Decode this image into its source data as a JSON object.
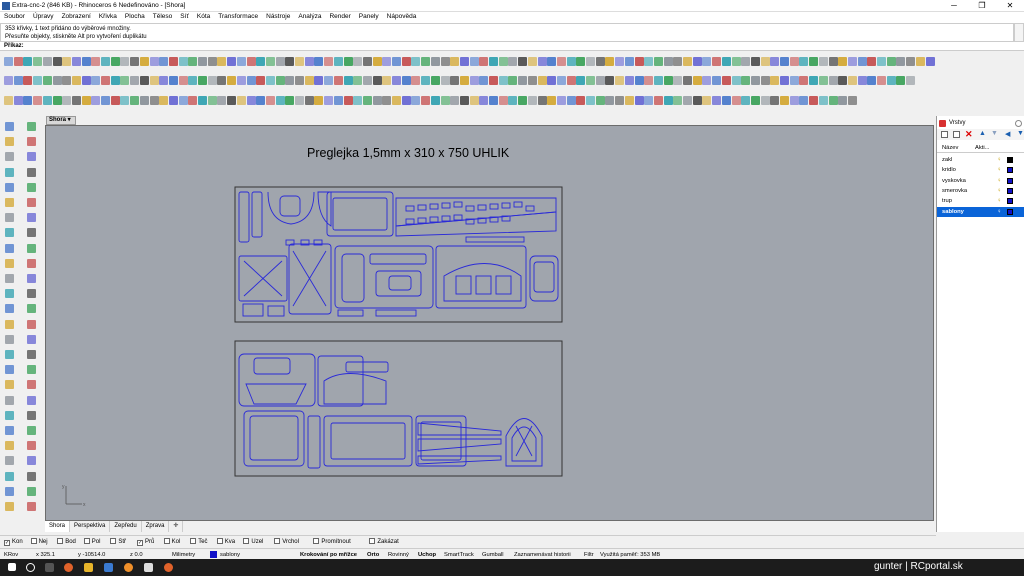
{
  "window": {
    "title": "Extra-cnc-2 (846 KB) - Rhinoceros 6 Nedefinováno - [Shora]",
    "controls": [
      "─",
      "❐",
      "✕"
    ]
  },
  "menu": [
    "Soubor",
    "Úpravy",
    "Zobrazení",
    "Křivka",
    "Plocha",
    "Těleso",
    "Síť",
    "Kóta",
    "Transformace",
    "Nástroje",
    "Analýza",
    "Render",
    "Panely",
    "Nápověda"
  ],
  "history": {
    "line1": "353 křivky, 1 text přidáno do výběrové množiny.",
    "line2": "Přesuňte objekty, stiskněte Alt pro vytvoření duplikátu"
  },
  "command": {
    "label": "Příkaz:"
  },
  "viewport": {
    "tab_label": "Shora",
    "title_text": "Preglejka 1,5mm x 310 x 750 UHLIK",
    "axis_x": "x",
    "axis_y": "y"
  },
  "view_tabs": [
    "Shora",
    "Perspektiva",
    "Zepředu",
    "Zprava",
    "✛"
  ],
  "osnap": [
    {
      "label": "Kon",
      "checked": true
    },
    {
      "label": "Nej",
      "checked": false
    },
    {
      "label": "Bod",
      "checked": false
    },
    {
      "label": "Pol",
      "checked": false
    },
    {
      "label": "Stř",
      "checked": false
    },
    {
      "label": "Prů",
      "checked": true
    },
    {
      "label": "Kol",
      "checked": false
    },
    {
      "label": "Teč",
      "checked": false
    },
    {
      "label": "Kva",
      "checked": false
    },
    {
      "label": "Uzel",
      "checked": false
    },
    {
      "label": "Vrchol",
      "checked": false
    },
    {
      "label": "Promítnout",
      "checked": false
    },
    {
      "label": "Zakázat",
      "checked": false
    }
  ],
  "status": {
    "cplane": "KRov",
    "x": "x 325.1",
    "y": "y -10514.0",
    "z": "z 0.0",
    "units": "Milimetry",
    "layer": "sablony",
    "grid_snap": "Krokování po mřížce",
    "ortho": "Orto",
    "planar": "Rovinný",
    "osnap": "Uchop",
    "smarttrack": "SmartTrack",
    "gumball": "Gumball",
    "history": "Zaznamenávat historii",
    "filter": "Filtr",
    "memory": "Využitá paměť: 353 MB"
  },
  "layers": {
    "tab_label": "Vrstvy",
    "col_name": "Název",
    "col_active": "Akti...",
    "items": [
      {
        "name": "zakl",
        "color": "#000000",
        "selected": false
      },
      {
        "name": "kridlo",
        "color": "#1010c8",
        "selected": false
      },
      {
        "name": "vyskovka",
        "color": "#1010c8",
        "selected": false
      },
      {
        "name": "smerovka",
        "color": "#1010c8",
        "selected": false
      },
      {
        "name": "trup",
        "color": "#1010c8",
        "selected": false
      },
      {
        "name": "sablony",
        "color": "#1010c8",
        "selected": true
      }
    ]
  },
  "watermark": "gunter | RCportal.sk",
  "colors": {
    "accent": "#0a64d8",
    "cut_lines": "#2a2ad8",
    "viewport_bg": "#a0a5ad"
  }
}
